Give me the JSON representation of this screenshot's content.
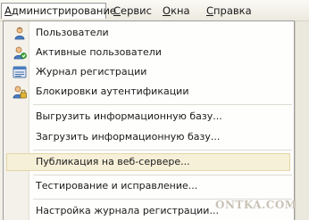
{
  "menubar": {
    "items": [
      {
        "label": "Администрирование",
        "underline_char": "А",
        "rest": "дминистрирование"
      },
      {
        "label": "Сервис",
        "underline_char": "С",
        "rest": "ервис"
      },
      {
        "label": "Окна",
        "underline_char": "О",
        "rest": "кна"
      },
      {
        "label": "Справка",
        "underline_char": "С",
        "rest": "правка"
      }
    ]
  },
  "dropdown": {
    "items": [
      {
        "label": "Пользователи",
        "icon": "user-icon"
      },
      {
        "label": "Активные пользователи",
        "icon": "active-users-icon"
      },
      {
        "label": "Журнал регистрации",
        "icon": "log-icon"
      },
      {
        "label": "Блокировки аутентификации",
        "icon": "lock-user-icon"
      },
      {
        "label": "Выгрузить информационную базу..."
      },
      {
        "label": "Загрузить информационную базу..."
      },
      {
        "label": "Публикация на веб-сервере..."
      },
      {
        "label": "Тестирование и исправление..."
      },
      {
        "label": "Настройка журнала регистрации..."
      }
    ]
  },
  "watermark": "ONTKA.COM",
  "colors": {
    "highlight_bg": "#f7f0d8",
    "highlight_border": "#e5d6a6",
    "gutter": "#f3f1ea",
    "menubar": "#ece9df"
  }
}
